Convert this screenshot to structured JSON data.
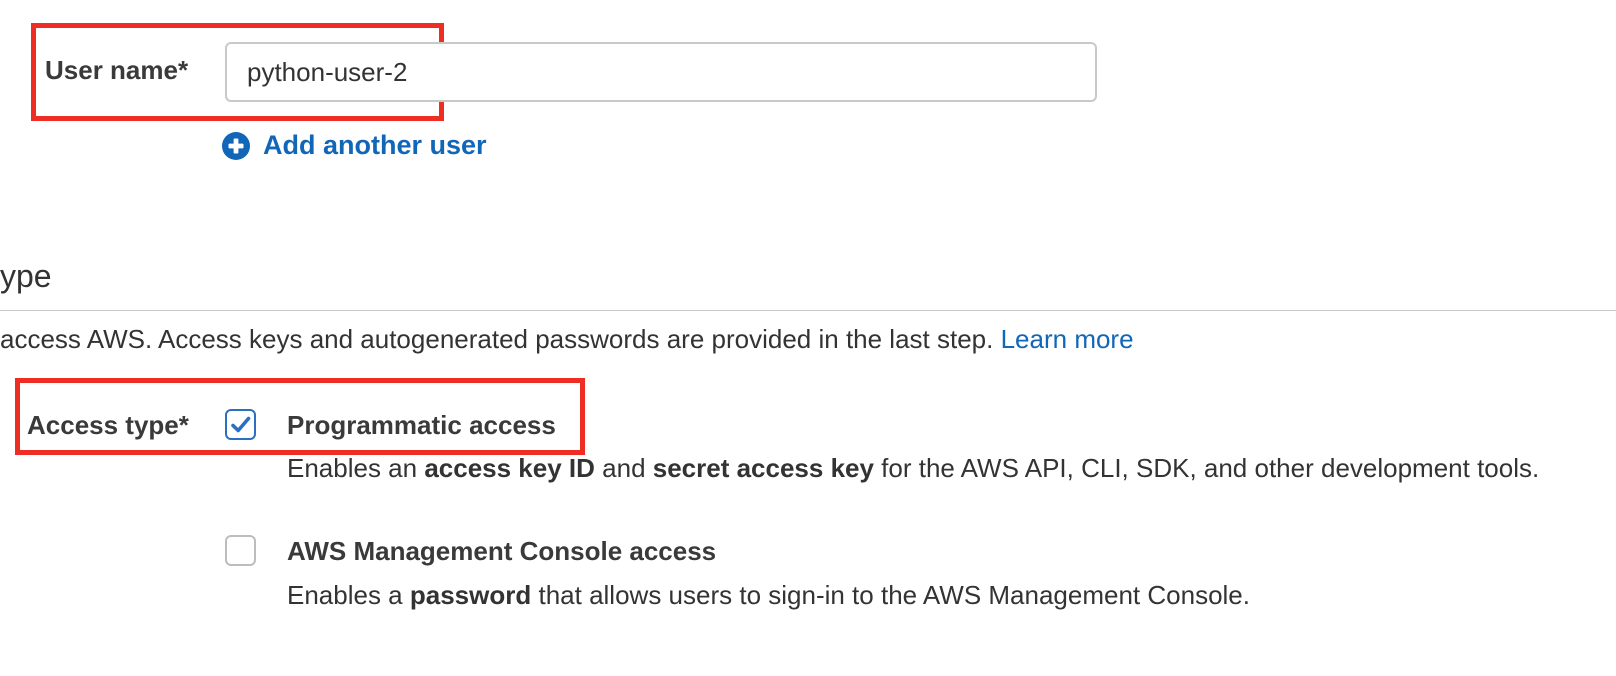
{
  "user_details": {
    "username_label": "User name*",
    "username_value": "python-user-2",
    "add_user_label": "Add another user",
    "add_user_icon": "plus-circle-icon"
  },
  "access_section": {
    "title": "ype",
    "description_text": "access AWS. Access keys and autogenerated passwords are provided in the last step. ",
    "learn_more_label": "Learn more",
    "access_type_label": "Access type*",
    "options": [
      {
        "title": "Programmatic access",
        "checked": true,
        "desc_pre": "Enables an ",
        "desc_bold1": "access key ID",
        "desc_mid": " and ",
        "desc_bold2": "secret access key",
        "desc_post": " for the AWS API, CLI, SDK, and other development tools."
      },
      {
        "title": "AWS Management Console access",
        "checked": false,
        "desc_pre": "Enables a ",
        "desc_bold1": "password",
        "desc_post": " that allows users to sign-in to the AWS Management Console."
      }
    ]
  },
  "colors": {
    "link": "#1266b8",
    "highlight": "#ee2d24",
    "checkbox_checked": "#2b6fc4"
  }
}
